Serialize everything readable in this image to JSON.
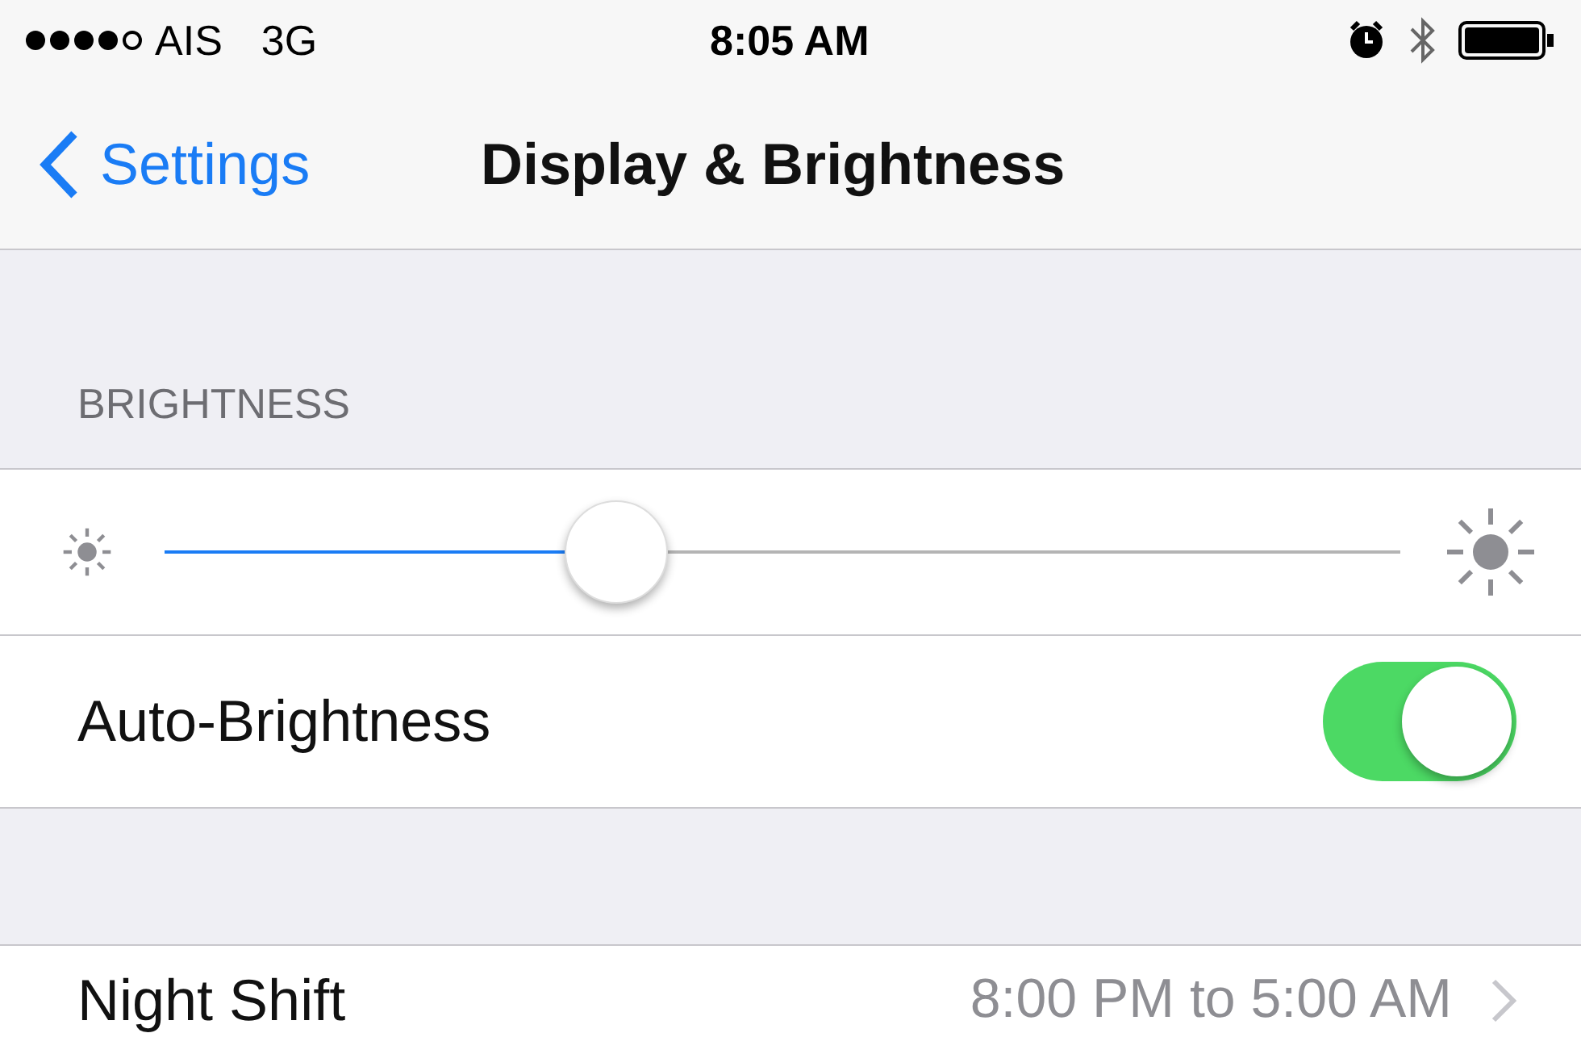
{
  "status_bar": {
    "signal_dots": [
      {
        "filled": true
      },
      {
        "filled": true
      },
      {
        "filled": true
      },
      {
        "filled": true
      },
      {
        "filled": false
      }
    ],
    "carrier": "AIS",
    "network": "3G",
    "time": "8:05 AM"
  },
  "nav": {
    "back": "Settings",
    "title": "Display & Brightness"
  },
  "brightness": {
    "header": "BRIGHTNESS",
    "level": 0.365
  },
  "auto_brightness": {
    "label": "Auto-Brightness",
    "on": true
  },
  "night_shift": {
    "label": "Night Shift",
    "value": "8:00 PM to 5:00 AM"
  }
}
